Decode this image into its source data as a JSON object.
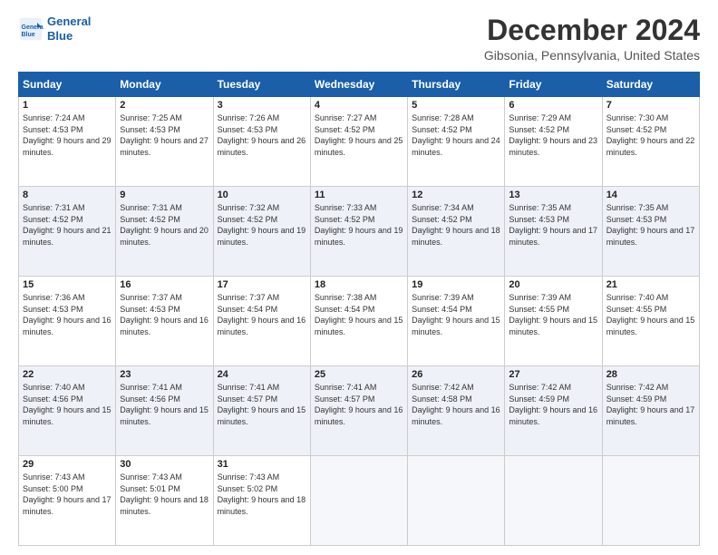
{
  "header": {
    "logo_line1": "General",
    "logo_line2": "Blue",
    "title": "December 2024",
    "location": "Gibsonia, Pennsylvania, United States"
  },
  "weekdays": [
    "Sunday",
    "Monday",
    "Tuesday",
    "Wednesday",
    "Thursday",
    "Friday",
    "Saturday"
  ],
  "weeks": [
    [
      {
        "day": "1",
        "sunrise": "7:24 AM",
        "sunset": "4:53 PM",
        "daylight": "9 hours and 29 minutes."
      },
      {
        "day": "2",
        "sunrise": "7:25 AM",
        "sunset": "4:53 PM",
        "daylight": "9 hours and 27 minutes."
      },
      {
        "day": "3",
        "sunrise": "7:26 AM",
        "sunset": "4:53 PM",
        "daylight": "9 hours and 26 minutes."
      },
      {
        "day": "4",
        "sunrise": "7:27 AM",
        "sunset": "4:52 PM",
        "daylight": "9 hours and 25 minutes."
      },
      {
        "day": "5",
        "sunrise": "7:28 AM",
        "sunset": "4:52 PM",
        "daylight": "9 hours and 24 minutes."
      },
      {
        "day": "6",
        "sunrise": "7:29 AM",
        "sunset": "4:52 PM",
        "daylight": "9 hours and 23 minutes."
      },
      {
        "day": "7",
        "sunrise": "7:30 AM",
        "sunset": "4:52 PM",
        "daylight": "9 hours and 22 minutes."
      }
    ],
    [
      {
        "day": "8",
        "sunrise": "7:31 AM",
        "sunset": "4:52 PM",
        "daylight": "9 hours and 21 minutes."
      },
      {
        "day": "9",
        "sunrise": "7:31 AM",
        "sunset": "4:52 PM",
        "daylight": "9 hours and 20 minutes."
      },
      {
        "day": "10",
        "sunrise": "7:32 AM",
        "sunset": "4:52 PM",
        "daylight": "9 hours and 19 minutes."
      },
      {
        "day": "11",
        "sunrise": "7:33 AM",
        "sunset": "4:52 PM",
        "daylight": "9 hours and 19 minutes."
      },
      {
        "day": "12",
        "sunrise": "7:34 AM",
        "sunset": "4:52 PM",
        "daylight": "9 hours and 18 minutes."
      },
      {
        "day": "13",
        "sunrise": "7:35 AM",
        "sunset": "4:53 PM",
        "daylight": "9 hours and 17 minutes."
      },
      {
        "day": "14",
        "sunrise": "7:35 AM",
        "sunset": "4:53 PM",
        "daylight": "9 hours and 17 minutes."
      }
    ],
    [
      {
        "day": "15",
        "sunrise": "7:36 AM",
        "sunset": "4:53 PM",
        "daylight": "9 hours and 16 minutes."
      },
      {
        "day": "16",
        "sunrise": "7:37 AM",
        "sunset": "4:53 PM",
        "daylight": "9 hours and 16 minutes."
      },
      {
        "day": "17",
        "sunrise": "7:37 AM",
        "sunset": "4:54 PM",
        "daylight": "9 hours and 16 minutes."
      },
      {
        "day": "18",
        "sunrise": "7:38 AM",
        "sunset": "4:54 PM",
        "daylight": "9 hours and 15 minutes."
      },
      {
        "day": "19",
        "sunrise": "7:39 AM",
        "sunset": "4:54 PM",
        "daylight": "9 hours and 15 minutes."
      },
      {
        "day": "20",
        "sunrise": "7:39 AM",
        "sunset": "4:55 PM",
        "daylight": "9 hours and 15 minutes."
      },
      {
        "day": "21",
        "sunrise": "7:40 AM",
        "sunset": "4:55 PM",
        "daylight": "9 hours and 15 minutes."
      }
    ],
    [
      {
        "day": "22",
        "sunrise": "7:40 AM",
        "sunset": "4:56 PM",
        "daylight": "9 hours and 15 minutes."
      },
      {
        "day": "23",
        "sunrise": "7:41 AM",
        "sunset": "4:56 PM",
        "daylight": "9 hours and 15 minutes."
      },
      {
        "day": "24",
        "sunrise": "7:41 AM",
        "sunset": "4:57 PM",
        "daylight": "9 hours and 15 minutes."
      },
      {
        "day": "25",
        "sunrise": "7:41 AM",
        "sunset": "4:57 PM",
        "daylight": "9 hours and 16 minutes."
      },
      {
        "day": "26",
        "sunrise": "7:42 AM",
        "sunset": "4:58 PM",
        "daylight": "9 hours and 16 minutes."
      },
      {
        "day": "27",
        "sunrise": "7:42 AM",
        "sunset": "4:59 PM",
        "daylight": "9 hours and 16 minutes."
      },
      {
        "day": "28",
        "sunrise": "7:42 AM",
        "sunset": "4:59 PM",
        "daylight": "9 hours and 17 minutes."
      }
    ],
    [
      {
        "day": "29",
        "sunrise": "7:43 AM",
        "sunset": "5:00 PM",
        "daylight": "9 hours and 17 minutes."
      },
      {
        "day": "30",
        "sunrise": "7:43 AM",
        "sunset": "5:01 PM",
        "daylight": "9 hours and 18 minutes."
      },
      {
        "day": "31",
        "sunrise": "7:43 AM",
        "sunset": "5:02 PM",
        "daylight": "9 hours and 18 minutes."
      },
      null,
      null,
      null,
      null
    ]
  ]
}
